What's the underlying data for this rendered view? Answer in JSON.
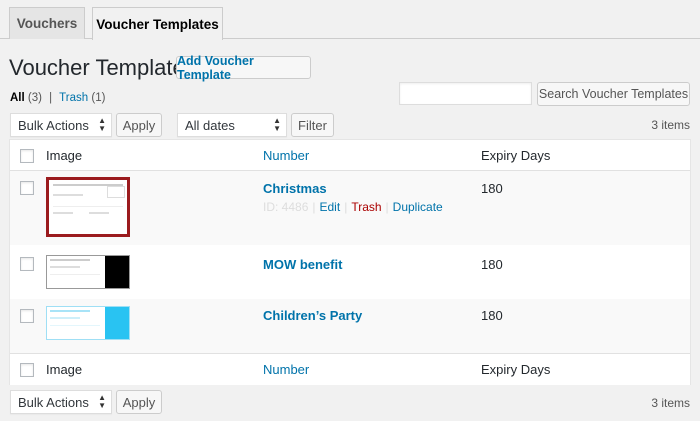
{
  "tabs": [
    {
      "label": "Vouchers",
      "active": false
    },
    {
      "label": "Voucher Templates",
      "active": true
    }
  ],
  "page": {
    "title": "Voucher Templates",
    "add_button": "Add Voucher Template"
  },
  "filters": {
    "all_label": "All",
    "all_count": "(3)",
    "separator": "|",
    "trash_label": "Trash",
    "trash_count": "(1)"
  },
  "search": {
    "value": "",
    "button": "Search Voucher Templates"
  },
  "tablenav_top": {
    "bulk_actions": "Bulk Actions",
    "apply": "Apply",
    "dates": "All dates",
    "filter": "Filter",
    "items": "3 items"
  },
  "tablenav_bottom": {
    "bulk_actions": "Bulk Actions",
    "apply": "Apply",
    "items": "3 items"
  },
  "table": {
    "columns": [
      "Image",
      "Number",
      "Expiry Days"
    ],
    "rows": [
      {
        "title": "Christmas",
        "expiry": "180",
        "actions": {
          "id": "ID: 4486",
          "edit": "Edit",
          "trash": "Trash",
          "duplicate": "Duplicate"
        },
        "thumb_color": "#9b1b1e"
      },
      {
        "title": "MOW benefit",
        "expiry": "180",
        "thumb_color": "#000000"
      },
      {
        "title": "Children’s Party",
        "expiry": "180",
        "thumb_color": "#29c3f2"
      }
    ]
  },
  "colors": {
    "link": "#0073aa",
    "trash": "#aa0000",
    "background": "#f1f1f1"
  }
}
